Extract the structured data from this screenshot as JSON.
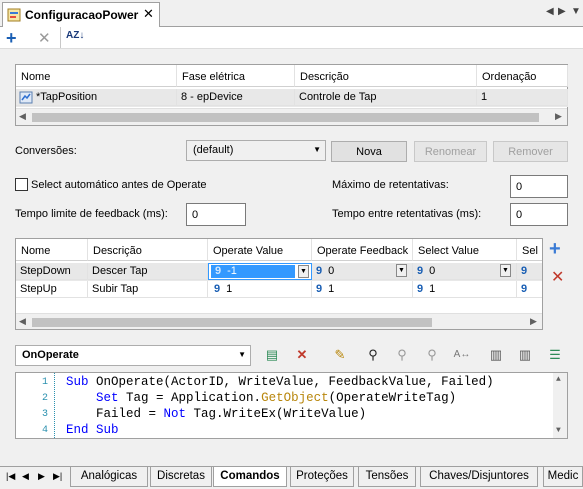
{
  "window": {
    "tab_title": "ConfiguracaoPower",
    "close_glyph": "✕"
  },
  "toolbar": {
    "add_glyph": "+",
    "delete_glyph": "✕",
    "sort_glyph": "AZ↓"
  },
  "tags_grid": {
    "columns": [
      "Nome",
      "Fase elétrica",
      "Descrição",
      "Ordenação"
    ],
    "rows": [
      {
        "nome": "*TapPosition",
        "fase": "8 - epDevice",
        "descricao": "Controle de Tap",
        "ordenacao": "1"
      }
    ]
  },
  "conversoes": {
    "label": "Conversões:",
    "value": "(default)",
    "buttons": {
      "nova": "Nova",
      "renomear": "Renomear",
      "remover": "Remover"
    }
  },
  "options": {
    "select_auto_label": "Select automático antes de Operate",
    "select_auto_checked": false,
    "max_retentativas_label": "Máximo de retentativas:",
    "max_retentativas_value": "0",
    "tempo_limite_label": "Tempo limite de feedback (ms):",
    "tempo_limite_value": "0",
    "tempo_entre_label": "Tempo entre retentativas (ms):",
    "tempo_entre_value": "0"
  },
  "commands_grid": {
    "columns": [
      "Nome",
      "Descrição",
      "Operate Value",
      "Operate Feedback",
      "Select Value",
      "Sel"
    ],
    "rows": [
      {
        "nome": "StepDown",
        "descricao": "Descer Tap",
        "operate_value": "-1",
        "operate_feedback": "0",
        "select_value": "0"
      },
      {
        "nome": "StepUp",
        "descricao": "Subir Tap",
        "operate_value": "1",
        "operate_feedback": "1",
        "select_value": "1"
      }
    ]
  },
  "script": {
    "event": "OnOperate",
    "lines": [
      {
        "n": "1",
        "parts": [
          {
            "t": "Sub",
            "c": "kw"
          },
          {
            "t": " OnOperate(ActorID, WriteValue, FeedbackValue, Failed)",
            "c": ""
          }
        ]
      },
      {
        "n": "2",
        "parts": [
          {
            "t": "    ",
            "c": ""
          },
          {
            "t": "Set",
            "c": "kw"
          },
          {
            "t": " Tag = Application.",
            "c": ""
          },
          {
            "t": "GetObject",
            "c": "fn"
          },
          {
            "t": "(OperateWriteTag)",
            "c": ""
          }
        ]
      },
      {
        "n": "3",
        "parts": [
          {
            "t": "    Failed = ",
            "c": ""
          },
          {
            "t": "Not",
            "c": "kw"
          },
          {
            "t": " Tag.WriteEx(WriteValue)",
            "c": ""
          }
        ]
      },
      {
        "n": "4",
        "parts": [
          {
            "t": "End Sub",
            "c": "kw"
          }
        ]
      }
    ]
  },
  "bottom_tabs": [
    {
      "label": "Analógicas",
      "active": false
    },
    {
      "label": "Discretas",
      "active": false
    },
    {
      "label": "Comandos",
      "active": true
    },
    {
      "label": "Proteções",
      "active": false
    },
    {
      "label": "Tensões",
      "active": false
    },
    {
      "label": "Chaves/Disjuntores",
      "active": false
    },
    {
      "label": "Medic",
      "active": false
    }
  ],
  "colors": {
    "accent_blue": "#1a5fb4",
    "delete_red": "#c0392b",
    "selection_blue": "#3399ff"
  }
}
